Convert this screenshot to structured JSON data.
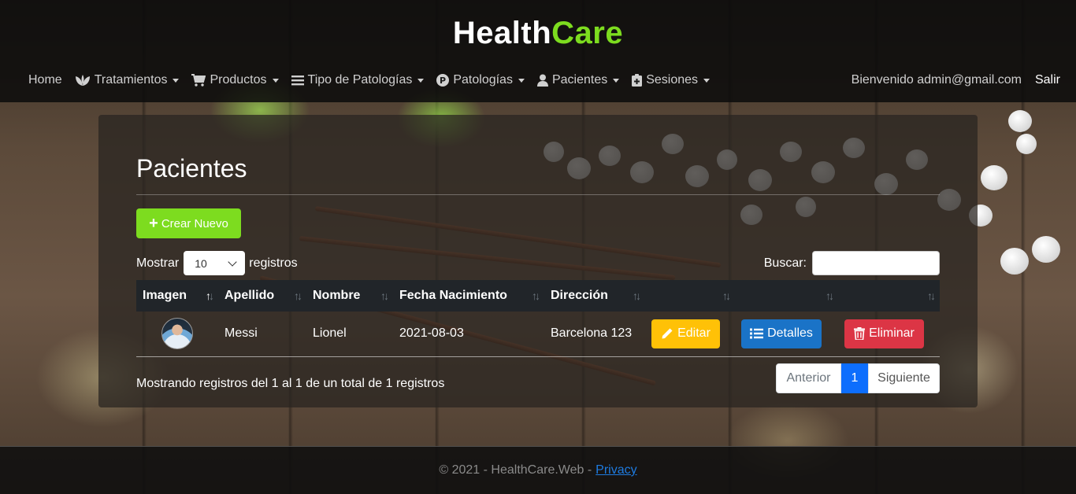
{
  "brand": {
    "part1": "Health",
    "part2": "Care"
  },
  "nav": {
    "items": [
      {
        "label": "Home",
        "icon": "",
        "dropdown": false
      },
      {
        "label": "Tratamientos",
        "icon": "leaf-icon",
        "dropdown": true
      },
      {
        "label": "Productos",
        "icon": "cart-icon",
        "dropdown": true
      },
      {
        "label": "Tipo de Patologías",
        "icon": "list-icon",
        "dropdown": true
      },
      {
        "label": "Patologías",
        "icon": "p-circle-icon",
        "dropdown": true
      },
      {
        "label": "Pacientes",
        "icon": "user-icon",
        "dropdown": true
      },
      {
        "label": "Sesiones",
        "icon": "clipboard-plus-icon",
        "dropdown": true
      }
    ],
    "welcome": "Bienvenido admin@gmail.com",
    "logout": "Salir"
  },
  "page": {
    "title": "Pacientes",
    "create_label": "Crear Nuevo",
    "show_prefix": "Mostrar",
    "show_value": "10",
    "show_suffix": "registros",
    "search_label": "Buscar:",
    "search_value": ""
  },
  "table": {
    "headers": [
      "Imagen",
      "Apellido",
      "Nombre",
      "Fecha Nacimiento",
      "Dirección",
      "",
      "",
      ""
    ],
    "rows": [
      {
        "apellido": "Messi",
        "nombre": "Lionel",
        "fecha": "2021-08-03",
        "direccion": "Barcelona 123",
        "edit": "Editar",
        "details": "Detalles",
        "delete": "Eliminar"
      }
    ]
  },
  "info": "Mostrando registros del 1 al 1 de un total de 1 registros",
  "pagination": {
    "prev": "Anterior",
    "current": "1",
    "next": "Siguiente"
  },
  "footer": {
    "text": "© 2021 - HealthCare.Web -",
    "link": "Privacy"
  },
  "colors": {
    "brand_green": "#7ddc1f",
    "edit": "#ffc107",
    "details": "#1a73c7",
    "delete": "#dc3545",
    "page_active": "#0d6efd"
  }
}
